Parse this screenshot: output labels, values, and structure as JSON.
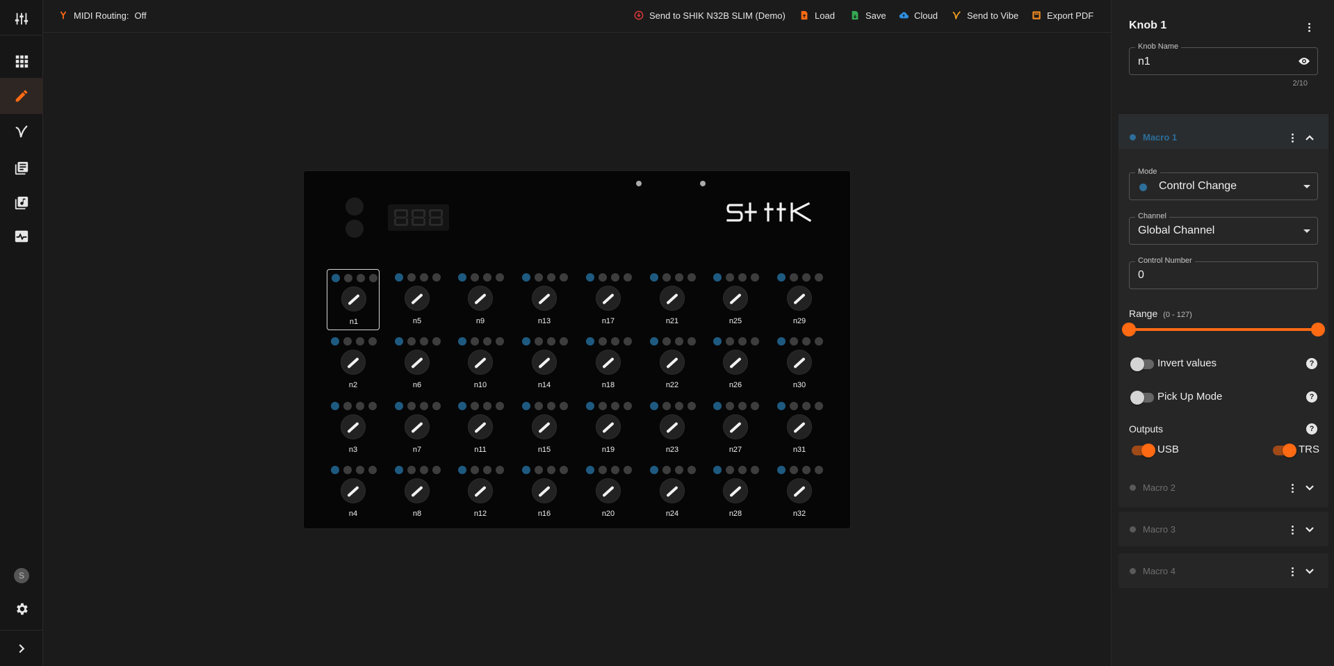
{
  "topbar": {
    "midi_routing_label": "MIDI Routing:",
    "midi_routing_value": "Off",
    "send_device": "Send to SHIK N32B SLIM (Demo)",
    "load": "Load",
    "save": "Save",
    "cloud": "Cloud",
    "send_vibe": "Send to Vibe",
    "export_pdf": "Export PDF"
  },
  "rail": {
    "avatar_initial": "S",
    "items": [
      "mixer-sliders-icon",
      "grid-icon",
      "pencil-icon",
      "vibe-logo-icon",
      "library-icon",
      "music-library-icon",
      "monitor-icon"
    ],
    "active_item": "pencil-icon"
  },
  "device": {
    "brand": "SHIK",
    "display": "888",
    "knob_columns": [
      [
        "n1",
        "n2",
        "n3",
        "n4"
      ],
      [
        "n5",
        "n6",
        "n7",
        "n8"
      ],
      [
        "n9",
        "n10",
        "n11",
        "n12"
      ],
      [
        "n13",
        "n14",
        "n15",
        "n16"
      ],
      [
        "n17",
        "n18",
        "n19",
        "n20"
      ],
      [
        "n21",
        "n22",
        "n23",
        "n24"
      ],
      [
        "n25",
        "n26",
        "n27",
        "n28"
      ],
      [
        "n29",
        "n30",
        "n31",
        "n32"
      ]
    ],
    "selected_knob": "n1"
  },
  "panel": {
    "title": "Knob 1",
    "knob_name_label": "Knob Name",
    "knob_name_value": "n1",
    "char_counter": "2/10",
    "macro1": {
      "name": "Macro 1",
      "mode_label": "Mode",
      "mode_value": "Control Change",
      "channel_label": "Channel",
      "channel_value": "Global Channel",
      "control_number_label": "Control Number",
      "control_number_value": "0",
      "range_label": "Range",
      "range_hint": "(0 - 127)",
      "range_min": 0,
      "range_max": 127,
      "invert_label": "Invert values",
      "invert_on": false,
      "pickup_label": "Pick Up Mode",
      "pickup_on": false,
      "outputs_label": "Outputs",
      "usb_label": "USB",
      "usb_on": true,
      "trs_label": "TRS",
      "trs_on": true
    },
    "other_macros": [
      "Macro 2",
      "Macro 3",
      "Macro 4"
    ]
  },
  "colors": {
    "accent": "#ff6a13",
    "macro_active": "#2d6e9a",
    "led_on": "#1e5a80"
  }
}
